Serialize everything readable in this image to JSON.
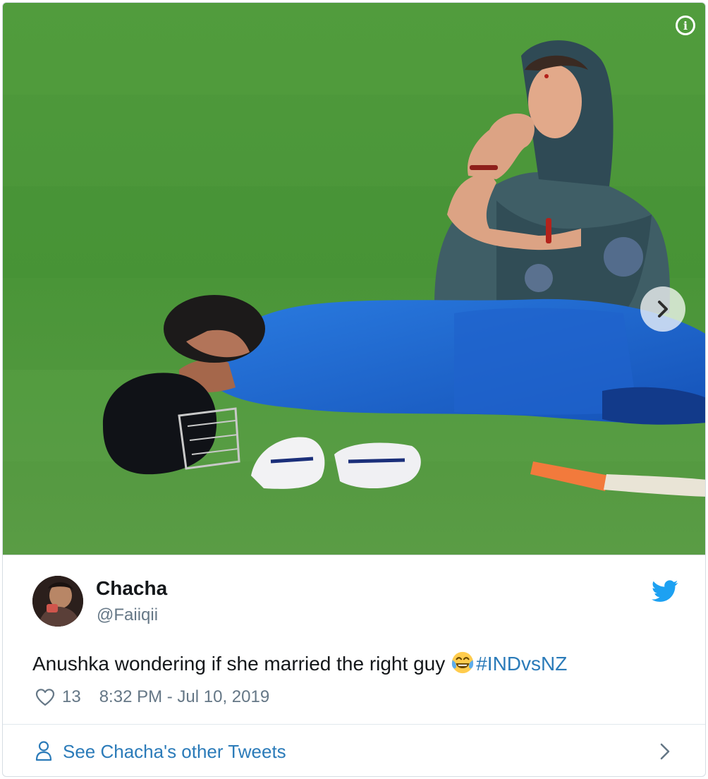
{
  "media": {
    "info_icon": "info-icon",
    "next_icon": "chevron-right-icon"
  },
  "tweet": {
    "author_name": "Chacha",
    "author_handle": "@Faiiqii",
    "text": "Anushka wondering if she married the right guy",
    "emoji": "face-with-tears-of-joy",
    "hashtag": "#INDvsNZ",
    "like_count": "13",
    "timestamp": "8:32 PM - Jul 10, 2019",
    "platform_icon": "twitter-bird-icon"
  },
  "footer": {
    "label": "See Chacha's other Tweets"
  },
  "colors": {
    "link": "#2b7bb9",
    "secondary_text": "#657786",
    "twitter_blue": "#1da1f2"
  }
}
